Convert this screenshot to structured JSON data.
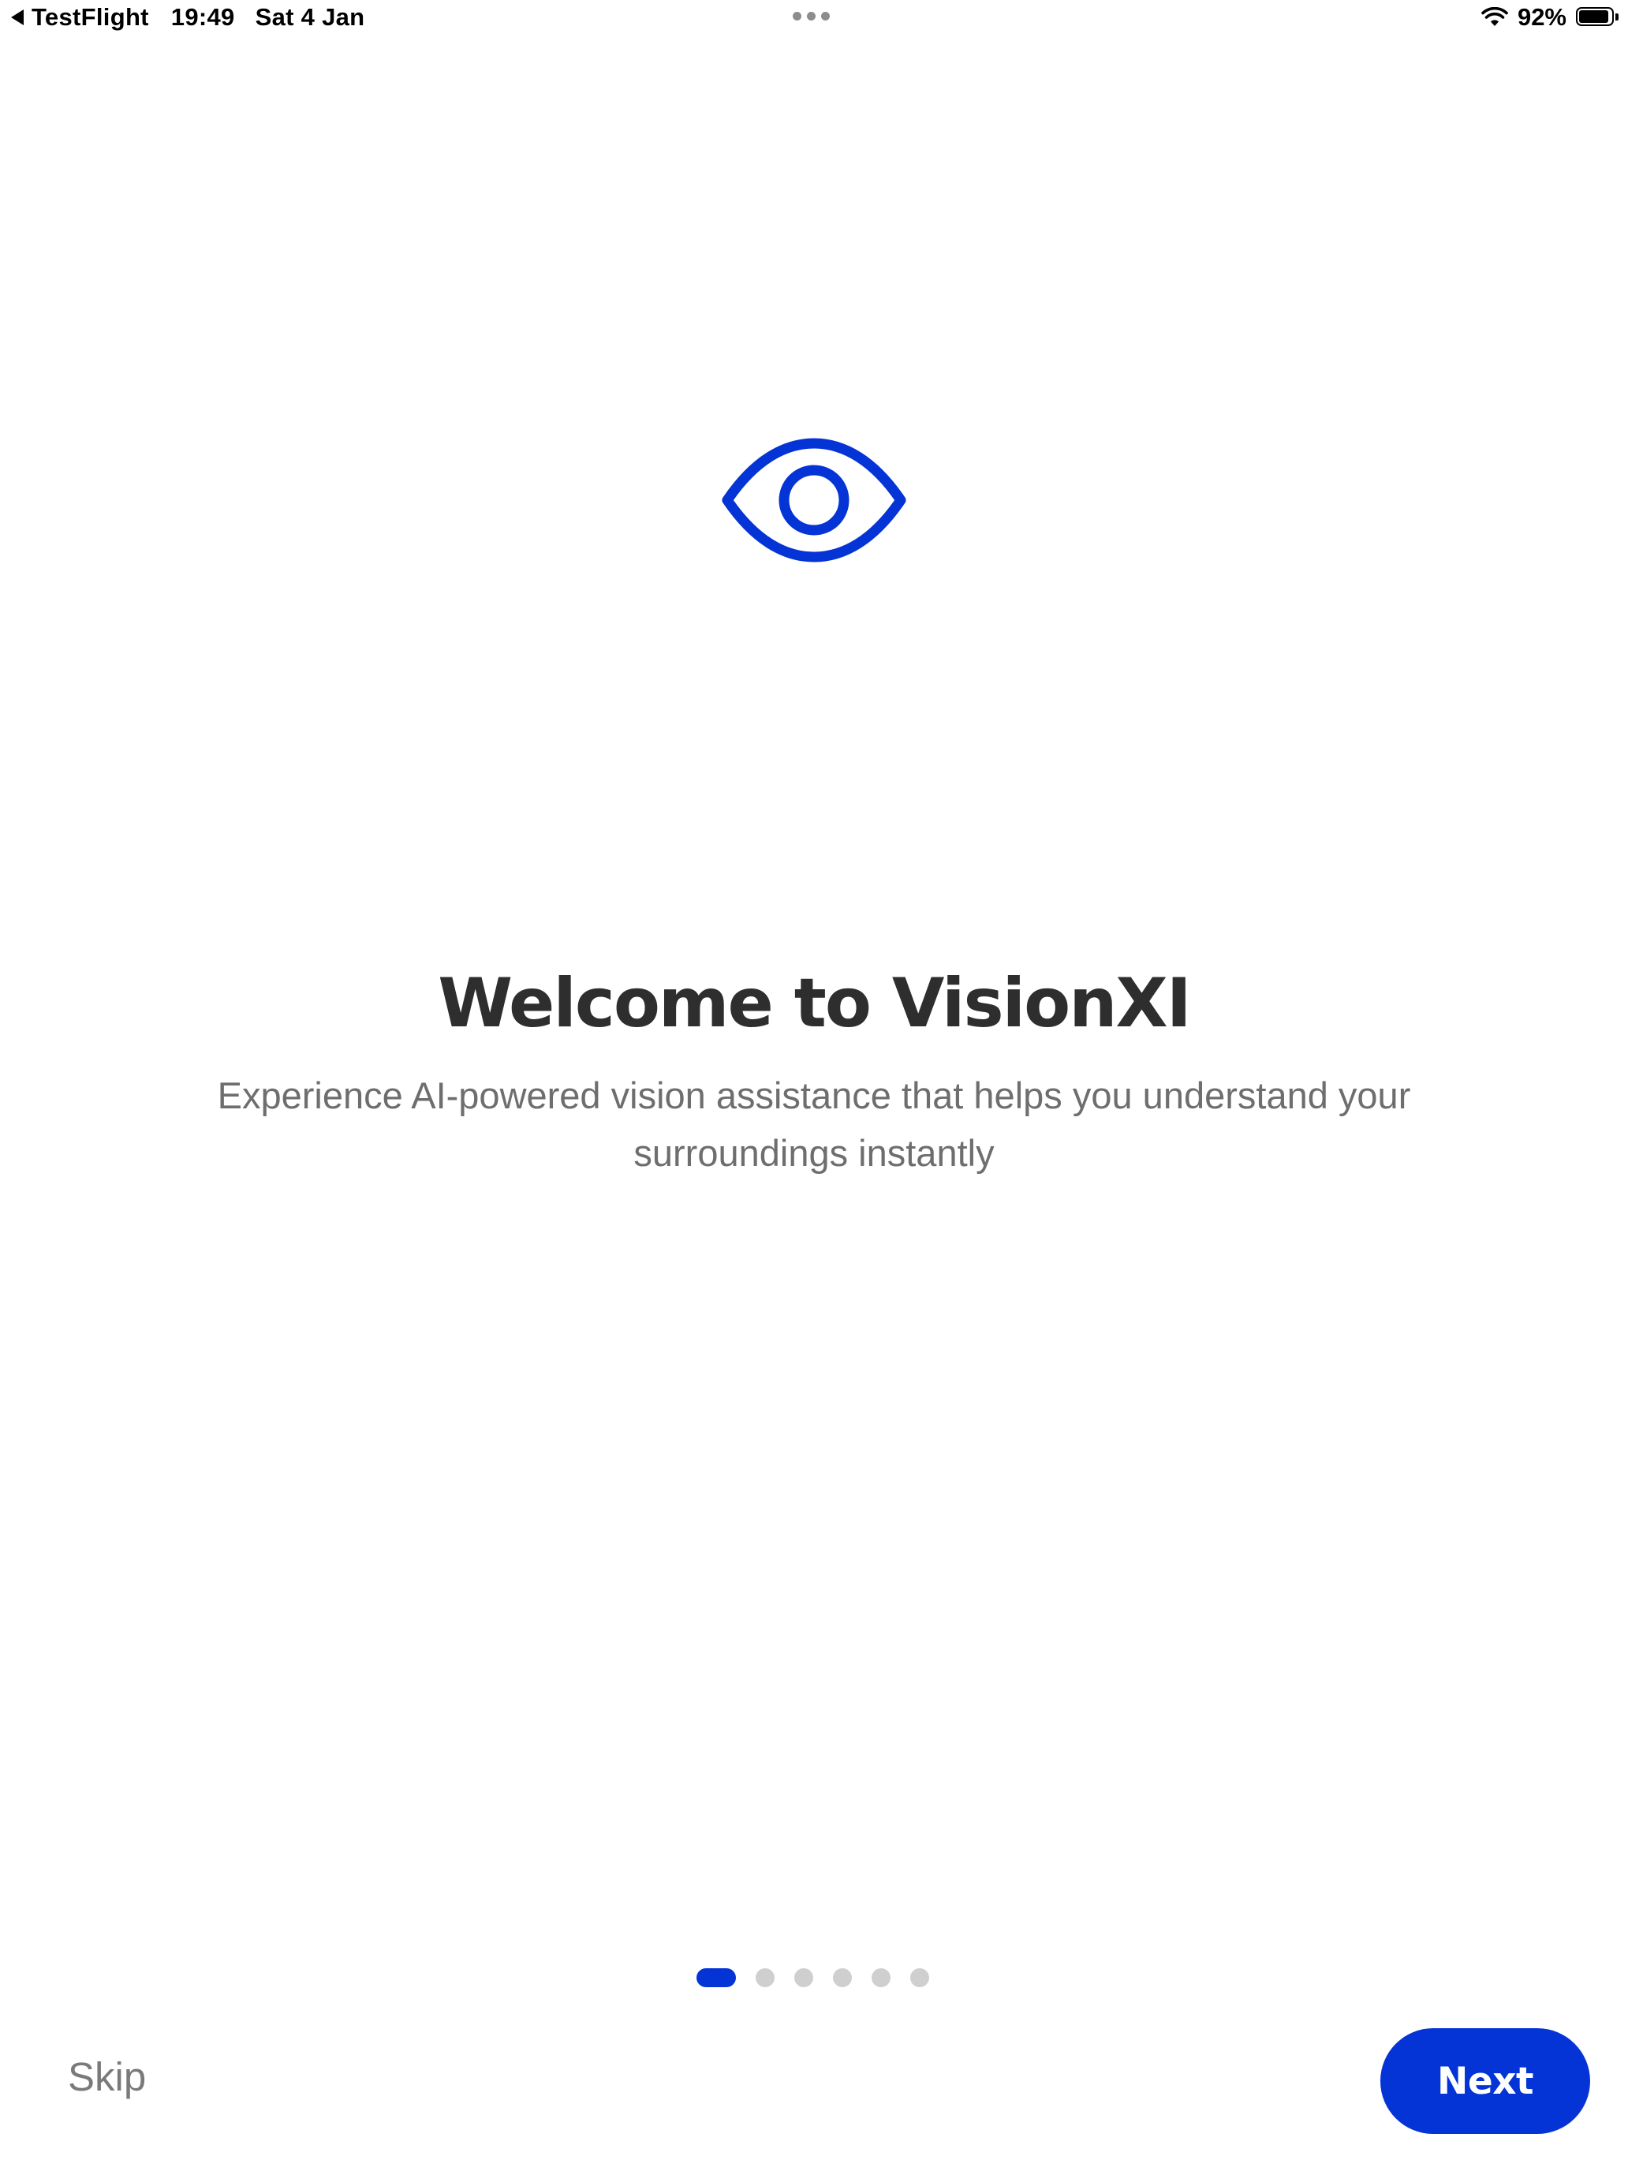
{
  "status_bar": {
    "back_app": "TestFlight",
    "time": "19:49",
    "date": "Sat 4 Jan",
    "battery_percent_label": "92%",
    "battery_level": 0.92
  },
  "onboarding": {
    "icon": "eye-icon",
    "title": "Welcome to VisionXI",
    "subtitle": "Experience AI-powered vision assistance that helps you understand your surroundings instantly",
    "page_count": 6,
    "current_page": 1,
    "skip_label": "Skip",
    "next_label": "Next"
  },
  "colors": {
    "accent": "#0534d6",
    "title": "#2e2e2e",
    "subtitle": "#6e6e6e",
    "inactive_dot": "#cfcfcf"
  }
}
